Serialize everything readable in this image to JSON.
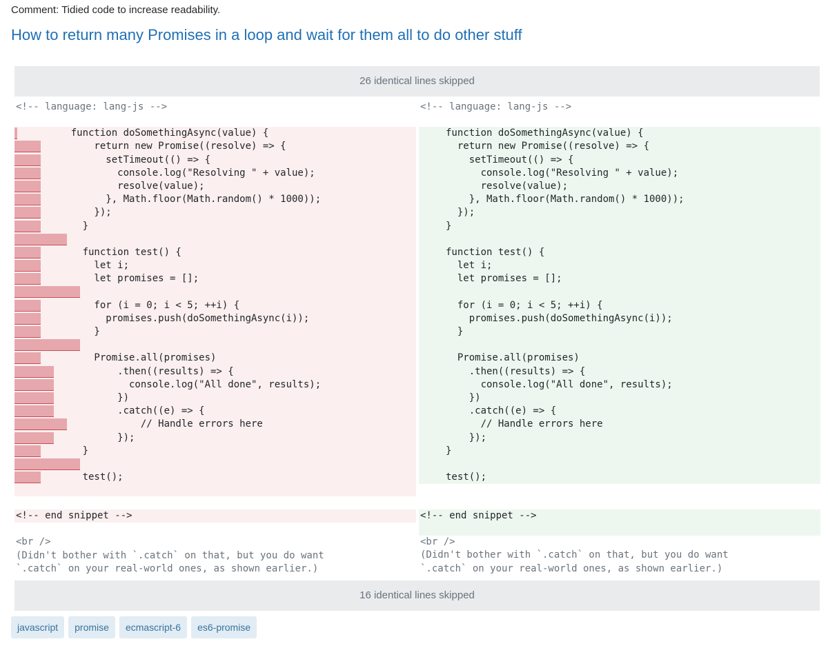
{
  "comment": "Comment: Tidied code to increase readability.",
  "title": "How to return many Promises in a loop and wait for them all to do other stuff",
  "skip_top": "26 identical lines skipped",
  "skip_bottom": "16 identical lines skipped",
  "left": {
    "lang_comment": "<!-- language: lang-js -->",
    "code": [
      "    function doSomethingAsync(value) {",
      "        return new Promise((resolve) => {",
      "          setTimeout(() => {",
      "            console.log(\"Resolving \" + value);",
      "            resolve(value);",
      "          }, Math.floor(Math.random() * 1000));",
      "        });",
      "      }",
      "",
      "      function test() {",
      "        let i;",
      "        let promises = [];",
      "",
      "        for (i = 0; i < 5; ++i) {",
      "          promises.push(doSomethingAsync(i));",
      "        }",
      "",
      "        Promise.all(promises)",
      "            .then((results) => {",
      "              console.log(\"All done\", results);",
      "            })",
      "            .catch((e) => {",
      "                // Handle errors here",
      "            });",
      "      }",
      "",
      "      test();"
    ],
    "end_snippet": "<!-- end snippet -->",
    "br": "<br />",
    "note_1": "(Didn't bother with `.catch` on that, but you do want",
    "note_2": "`.catch` on your real-world ones, as shown earlier.)"
  },
  "right": {
    "lang_comment": "<!-- language: lang-js -->",
    "code": [
      "function doSomethingAsync(value) {",
      "  return new Promise((resolve) => {",
      "    setTimeout(() => {",
      "      console.log(\"Resolving \" + value);",
      "      resolve(value);",
      "    }, Math.floor(Math.random() * 1000));",
      "  });",
      "}",
      "",
      "function test() {",
      "  let i;",
      "  let promises = [];",
      "",
      "  for (i = 0; i < 5; ++i) {",
      "    promises.push(doSomethingAsync(i));",
      "  }",
      "",
      "  Promise.all(promises)",
      "    .then((results) => {",
      "      console.log(\"All done\", results);",
      "    })",
      "    .catch((e) => {",
      "      // Handle errors here",
      "    });",
      "}",
      "",
      "test();"
    ],
    "end_snippet": "<!-- end snippet -->",
    "br": "<br />",
    "note_1": "(Didn't bother with `.catch` on that, but you do want",
    "note_2": "`.catch` on your real-world ones, as shown earlier.)"
  },
  "tags": [
    "javascript",
    "promise",
    "ecmascript-6",
    "es6-promise"
  ],
  "colors": {
    "title": "#1f6fb5",
    "deleted_bg": "#fbefef",
    "inserted_bg": "#eef7ef",
    "whitespace_mark": "#e6a8ad",
    "tag_bg": "#e1ecf4",
    "tag_text": "#39739d"
  }
}
